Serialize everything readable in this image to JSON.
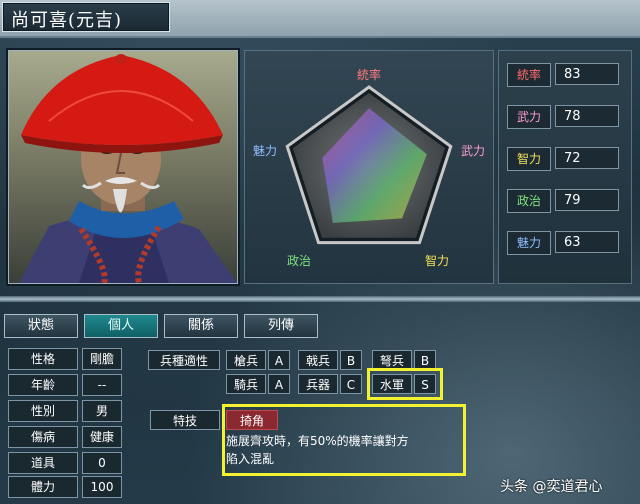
{
  "header": {
    "title": "尚可喜(元吉)"
  },
  "radar": {
    "labels": {
      "command": "統率",
      "war": "武力",
      "intelligence": "智力",
      "politics": "政治",
      "charm": "魅力"
    },
    "values": [
      83,
      78,
      72,
      79,
      63
    ],
    "max": 100
  },
  "stats": [
    {
      "name": "統率",
      "value": "83",
      "color": "#ff6a6a"
    },
    {
      "name": "武力",
      "value": "78",
      "color": "#ff9ad0"
    },
    {
      "name": "智力",
      "value": "72",
      "color": "#f5e05a"
    },
    {
      "name": "政治",
      "value": "79",
      "color": "#7fe07f"
    },
    {
      "name": "魅力",
      "value": "63",
      "color": "#8fbfff"
    }
  ],
  "tabs": [
    "狀態",
    "個人",
    "關係",
    "列傳"
  ],
  "info": [
    {
      "label": "性格",
      "value": "剛膽"
    },
    {
      "label": "年齡",
      "value": "--"
    },
    {
      "label": "性別",
      "value": "男"
    },
    {
      "label": "傷病",
      "value": "健康"
    },
    {
      "label": "道具",
      "value": "0"
    },
    {
      "label": "體力",
      "value": "100"
    }
  ],
  "aptitude": {
    "title": "兵種適性",
    "units": [
      {
        "name": "槍兵",
        "grade": "A"
      },
      {
        "name": "戟兵",
        "grade": "B"
      },
      {
        "name": "弩兵",
        "grade": "B"
      },
      {
        "name": "騎兵",
        "grade": "A"
      },
      {
        "name": "兵器",
        "grade": "C"
      },
      {
        "name": "水軍",
        "grade": "S"
      }
    ]
  },
  "skill": {
    "label": "特技",
    "name": "掎角",
    "description_line1": "施展齊攻時，有50%的機率讓對方",
    "description_line2": "陷入混亂"
  },
  "watermark": "头条 @奕道君心"
}
